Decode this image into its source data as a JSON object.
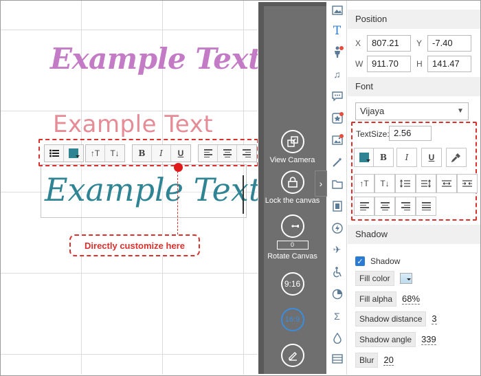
{
  "canvas": {
    "example_text_1": "Example Text",
    "example_text_2": "Example Text",
    "example_text_3": "Example Text",
    "callout": "Directly customize here"
  },
  "camera_panel": {
    "view_camera": "View Camera",
    "lock_canvas": "Lock the canvas",
    "rotate_canvas": "Rotate Canvas",
    "rotate_value": "0",
    "ratio_9_16": "9:16",
    "ratio_16_9": "16:9"
  },
  "float_toolbar": {
    "bold": "B",
    "italic": "I",
    "underline": "U",
    "increase_size": "↑T",
    "decrease_size": "T↓"
  },
  "icon_strip": [
    "image-icon",
    "text-icon",
    "person-icon",
    "music-icon",
    "speech-bubble-icon",
    "sticker-icon",
    "picture-icon",
    "magic-wand-icon",
    "folder-icon",
    "film-icon",
    "flash-icon",
    "airplane-icon",
    "accessibility-icon",
    "pie-chart-icon",
    "sigma-icon",
    "drop-icon",
    "layers-icon"
  ],
  "properties": {
    "position": {
      "heading": "Position",
      "x_label": "X",
      "x_value": "807.21",
      "y_label": "Y",
      "y_value": "-7.40",
      "w_label": "W",
      "w_value": "911.70",
      "h_label": "H",
      "h_value": "141.47"
    },
    "font": {
      "heading": "Font",
      "family": "Vijaya",
      "text_size_label": "TextSize:",
      "text_size_value": "2.56",
      "bold": "B",
      "italic": "I",
      "underline": "U",
      "increase_size": "↑T",
      "decrease_size": "T↓",
      "color": "#2f8494"
    },
    "shadow": {
      "heading": "Shadow",
      "checkbox_label": "Shadow",
      "enabled": true,
      "fill_color_label": "Fill color",
      "fill_alpha_label": "Fill alpha",
      "fill_alpha_value": "68%",
      "distance_label": "Shadow distance",
      "distance_value": "3",
      "angle_label": "Shadow angle",
      "angle_value": "339",
      "blur_label": "Blur",
      "blur_value": "20"
    }
  },
  "colors": {
    "accent_red": "#d9302c",
    "text_teal": "#2f8494",
    "text_purple": "#c47bc6",
    "text_pink": "#e58c96",
    "panel_dark": "#6f6f6f",
    "active_blue": "#2a7bd4"
  }
}
